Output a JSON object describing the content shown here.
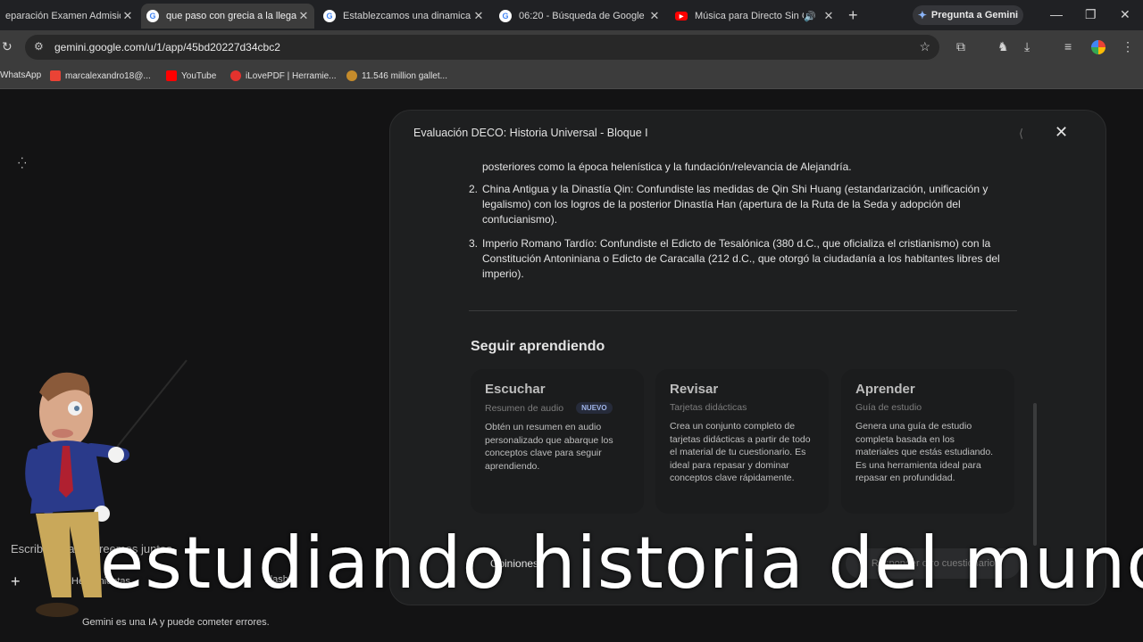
{
  "browser": {
    "tabs": [
      {
        "title": "eparación Examen Admisión",
        "icon": "google-icon",
        "active": false
      },
      {
        "title": "que paso con grecia a la llegad",
        "icon": "google-icon",
        "active": true
      },
      {
        "title": "Establezcamos una dinamica p",
        "icon": "google-icon",
        "active": false
      },
      {
        "title": "06:20 - Búsqueda de Google",
        "icon": "google-icon",
        "active": false
      },
      {
        "title": "Música para Directo Sin Co",
        "icon": "youtube-icon",
        "active": false
      }
    ],
    "new_tab": "+",
    "gemini_button": "Pregunta a Gemini",
    "url": "gemini.google.com/u/1/app/45bd20227d34cbc2",
    "bookmarks": [
      {
        "label": "WhatsApp",
        "color": "#25d366"
      },
      {
        "label": "marcalexandro18@...",
        "color": "#ea4335"
      },
      {
        "label": "YouTube",
        "color": "#ff0000"
      },
      {
        "label": "iLovePDF | Herramie...",
        "color": "#e5322d"
      },
      {
        "label": "11.546 million gallet...",
        "color": "#c58b2b"
      }
    ]
  },
  "page": {
    "prompt_placeholder": "Escribe ideas o creemos juntos",
    "tools_label": "Herramientas",
    "model_label": "Flash",
    "disclaimer": "Gemini es una IA y puede cometer errores."
  },
  "dialog": {
    "title": "Evaluación DECO: Historia Universal - Bloque I",
    "partial_line": "posteriores como la época helenística y la fundación/relevancia de Alejandría.",
    "mistakes": [
      {
        "num": "2.",
        "text": "China Antigua y la Dinastía Qin: Confundiste las medidas de Qin Shi Huang (estandarización, unificación y legalismo) con los logros de la posterior Dinastía Han (apertura de la Ruta de la Seda y adopción del confucianismo)."
      },
      {
        "num": "3.",
        "text": "Imperio Romano Tardío: Confundiste el Edicto de Tesalónica (380 d.C., que oficializa el cristianismo) con la Constitución Antoniniana o Edicto de Caracalla (212 d.C., que otorgó la ciudadanía a los habitantes libres del imperio)."
      }
    ],
    "section_title": "Seguir aprendiendo",
    "cards": [
      {
        "title": "Escuchar",
        "subtitle": "Resumen de audio",
        "badge": "NUEVO",
        "desc": "Obtén un resumen en audio personalizado que abarque los conceptos clave para seguir aprendiendo."
      },
      {
        "title": "Revisar",
        "subtitle": "Tarjetas didácticas",
        "badge": "",
        "desc": "Crea un conjunto completo de tarjetas didácticas a partir de todo el material de tu cuestionario. Es ideal para repasar y dominar conceptos clave rápidamente."
      },
      {
        "title": "Aprender",
        "subtitle": "Guía de estudio",
        "badge": "",
        "desc": "Genera una guía de estudio completa basada en los materiales que estás estudiando. Es una herramienta ideal para repasar en profundidad."
      }
    ],
    "feedback_label": "Opiniones",
    "respond_button": "Responder otro cuestionario"
  },
  "overlay": {
    "caption": "estudiando historia del mundo"
  }
}
